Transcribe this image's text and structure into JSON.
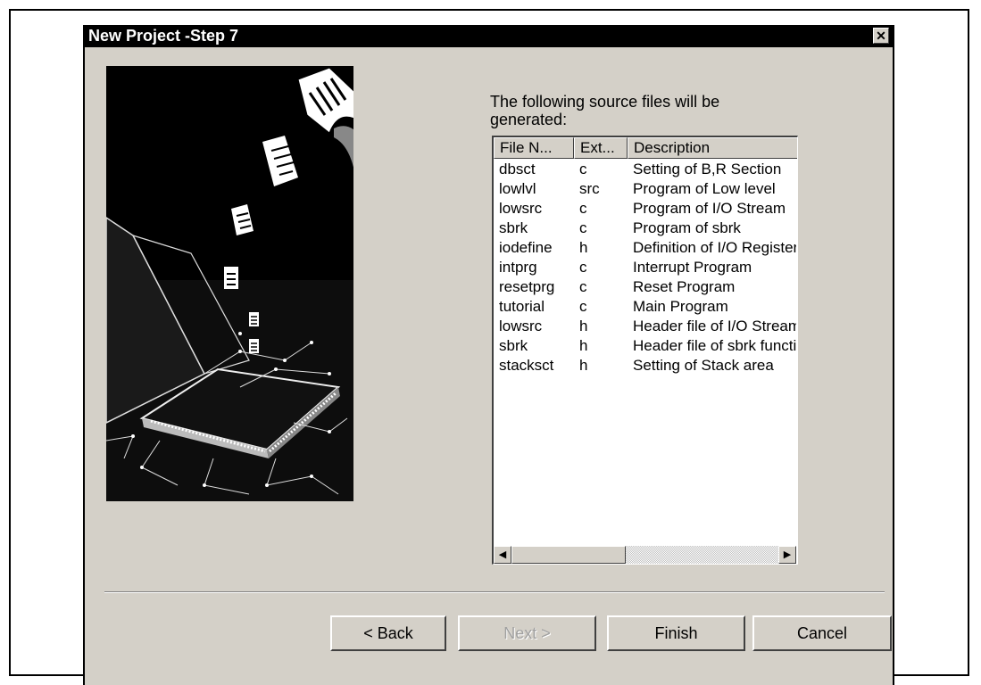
{
  "window": {
    "title": "New Project -Step 7",
    "close_glyph": "✕"
  },
  "prompt": "The following source files will be generated:",
  "list": {
    "columns": [
      "File N...",
      "Ext...",
      "Description"
    ],
    "rows": [
      [
        "dbsct",
        "c",
        "Setting of B,R Section"
      ],
      [
        "lowlvl",
        "src",
        "Program of Low level"
      ],
      [
        "lowsrc",
        "c",
        "Program of I/O Stream"
      ],
      [
        "sbrk",
        "c",
        "Program of sbrk"
      ],
      [
        "iodefine",
        "h",
        "Definition of I/O Register"
      ],
      [
        "intprg",
        "c",
        "Interrupt Program"
      ],
      [
        "resetprg",
        "c",
        "Reset Program"
      ],
      [
        "tutorial",
        "c",
        "Main Program"
      ],
      [
        "lowsrc",
        "h",
        "Header file of I/O Stream"
      ],
      [
        "sbrk",
        "h",
        "Header file of sbrk function"
      ],
      [
        "stacksct",
        "h",
        "Setting of Stack area"
      ]
    ],
    "scroll_left_glyph": "◀",
    "scroll_right_glyph": "▶"
  },
  "buttons": {
    "back": "< Back",
    "next": "Next >",
    "finish": "Finish",
    "cancel": "Cancel"
  },
  "icons": {
    "close": "close-icon",
    "wizard_art": "project-wizard-illustration-icon"
  },
  "colors": {
    "face": "#d4d0c8",
    "titlebar": "#000000",
    "disabled_text": "#a0a0a0"
  }
}
